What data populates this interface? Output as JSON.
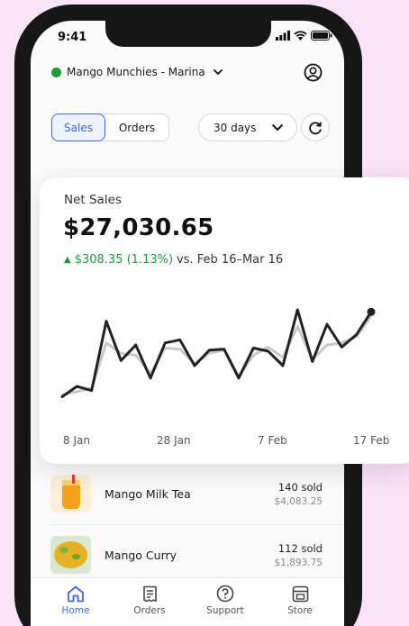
{
  "status_bar": {
    "time": "9:41"
  },
  "header": {
    "store_name": "Mango Munchies - Marina"
  },
  "controls": {
    "tabs": [
      {
        "label": "Sales",
        "active": true
      },
      {
        "label": "Orders",
        "active": false
      }
    ],
    "range_label": "30 days"
  },
  "net_sales": {
    "label": "Net Sales",
    "value": "$27,030.65",
    "change": "$308.35 (1.13%)",
    "comparison": "vs. Feb 16–Mar 16"
  },
  "chart_data": {
    "type": "line",
    "x_ticks": [
      "8 Jan",
      "28 Jan",
      "7 Feb",
      "17 Feb"
    ],
    "series": [
      {
        "values": [
          10,
          20,
          16,
          83,
          45,
          60,
          28,
          62,
          65,
          40,
          55,
          56,
          28,
          57,
          54,
          40,
          94,
          44,
          80,
          58,
          70,
          92
        ],
        "color": "#222222"
      },
      {
        "values": [
          12,
          15,
          18,
          62,
          52,
          50,
          32,
          57,
          56,
          42,
          52,
          55,
          30,
          50,
          58,
          48,
          78,
          46,
          60,
          62,
          68,
          88
        ],
        "color": "#c8c8c8"
      }
    ],
    "ylim": [
      0,
      100
    ],
    "grid": false
  },
  "products": [
    {
      "name": "Mango Milk Tea",
      "sold": "140 sold",
      "revenue": "$4,083.25"
    },
    {
      "name": "Mango Curry",
      "sold": "112 sold",
      "revenue": "$1,893.75"
    }
  ],
  "tabbar": [
    {
      "label": "Home",
      "icon": "home-icon",
      "active": true
    },
    {
      "label": "Orders",
      "icon": "receipt-icon",
      "active": false
    },
    {
      "label": "Support",
      "icon": "help-icon",
      "active": false
    },
    {
      "label": "Store",
      "icon": "store-icon",
      "active": false
    }
  ],
  "colors": {
    "accent": "#3a67d8",
    "positive": "#1d9b3a",
    "background": "#f9e3f7"
  }
}
